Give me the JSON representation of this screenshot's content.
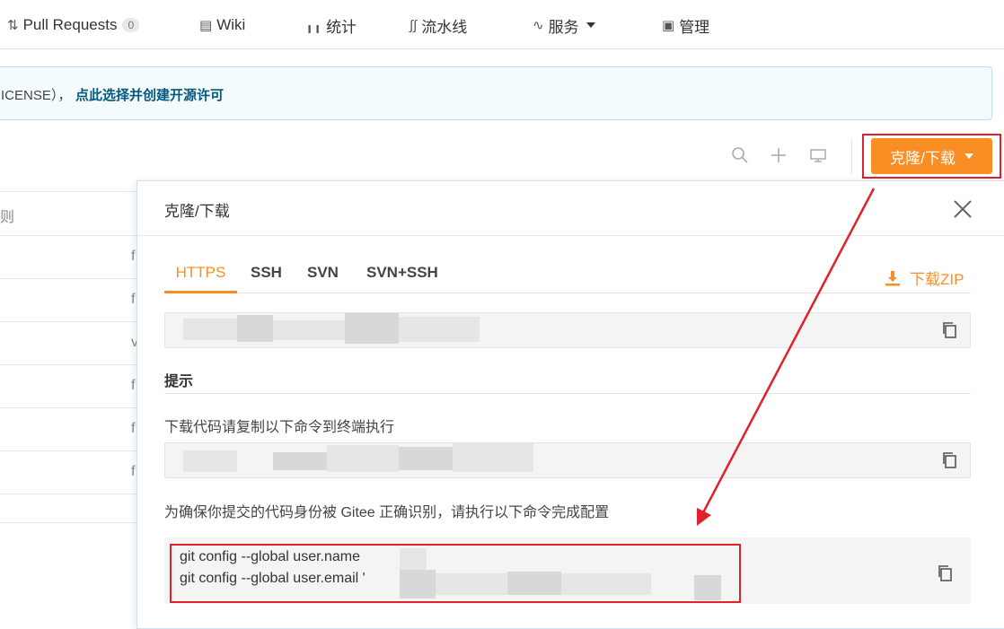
{
  "nav": {
    "items": [
      {
        "label": "Pull Requests",
        "badge": "0",
        "icon": "pull-request-icon"
      },
      {
        "label": "Wiki",
        "icon": "book-icon"
      },
      {
        "label": "统计",
        "icon": "chart-icon"
      },
      {
        "label": "流水线",
        "icon": "pipeline-icon"
      },
      {
        "label": "服务",
        "icon": "pulse-icon"
      },
      {
        "label": "管理",
        "icon": "manage-icon"
      }
    ]
  },
  "license": {
    "prefix": "ICENSE），",
    "link": "点此选择并创建开源许可"
  },
  "toolbar": {
    "clone_label": "克隆/下载"
  },
  "list": {
    "header": "则",
    "cells": [
      "f",
      "f",
      "v",
      "f",
      "f",
      "f"
    ]
  },
  "popup": {
    "title": "克隆/下载",
    "tabs": [
      "HTTPS",
      "SSH",
      "SVN",
      "SVN+SSH"
    ],
    "download_zip": "下载ZIP",
    "hint_title": "提示",
    "hint_download": "下载代码请复制以下命令到终端执行",
    "hint_config": "为确保你提交的代码身份被 Gitee 正确识别，请执行以下命令完成配置",
    "code_line_1": "git config --global user.name",
    "code_line_2": "git config --global user.email '"
  },
  "colors": {
    "accent": "#fa8e25",
    "link": "#005980",
    "annotation": "#e0202a"
  }
}
